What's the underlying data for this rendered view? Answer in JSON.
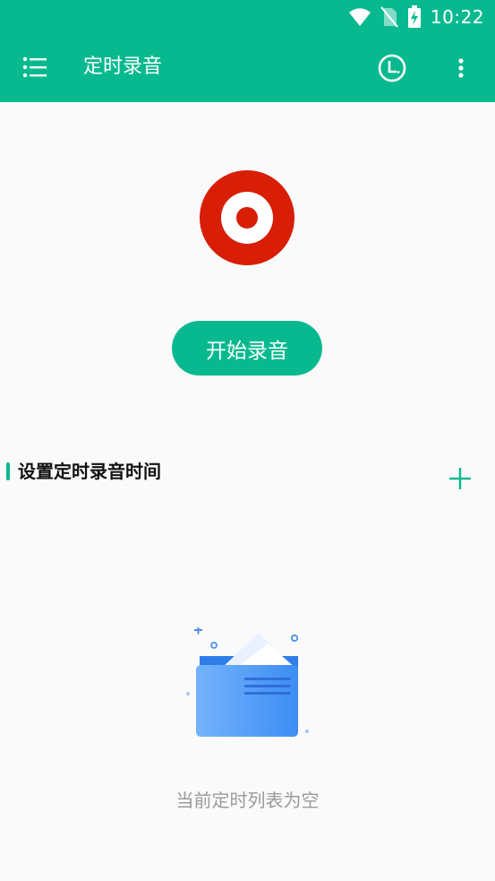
{
  "status_bar": {
    "time": "10:22",
    "icons": [
      "wifi-icon",
      "no-sim-icon",
      "battery-charging-icon"
    ]
  },
  "toolbar": {
    "title": "定时录音",
    "menu_icon": "list-menu-icon",
    "history_icon": "clock-icon",
    "more_icon": "more-vertical-icon"
  },
  "recorder": {
    "icon": "record-target-icon",
    "start_label": "开始录音"
  },
  "schedule": {
    "section_title": "设置定时录音时间",
    "add_icon": "plus-icon",
    "empty_text": "当前定时列表为空"
  },
  "colors": {
    "accent": "#08b98f",
    "record_red": "#d81e06",
    "empty_text": "#9a9a9a"
  }
}
